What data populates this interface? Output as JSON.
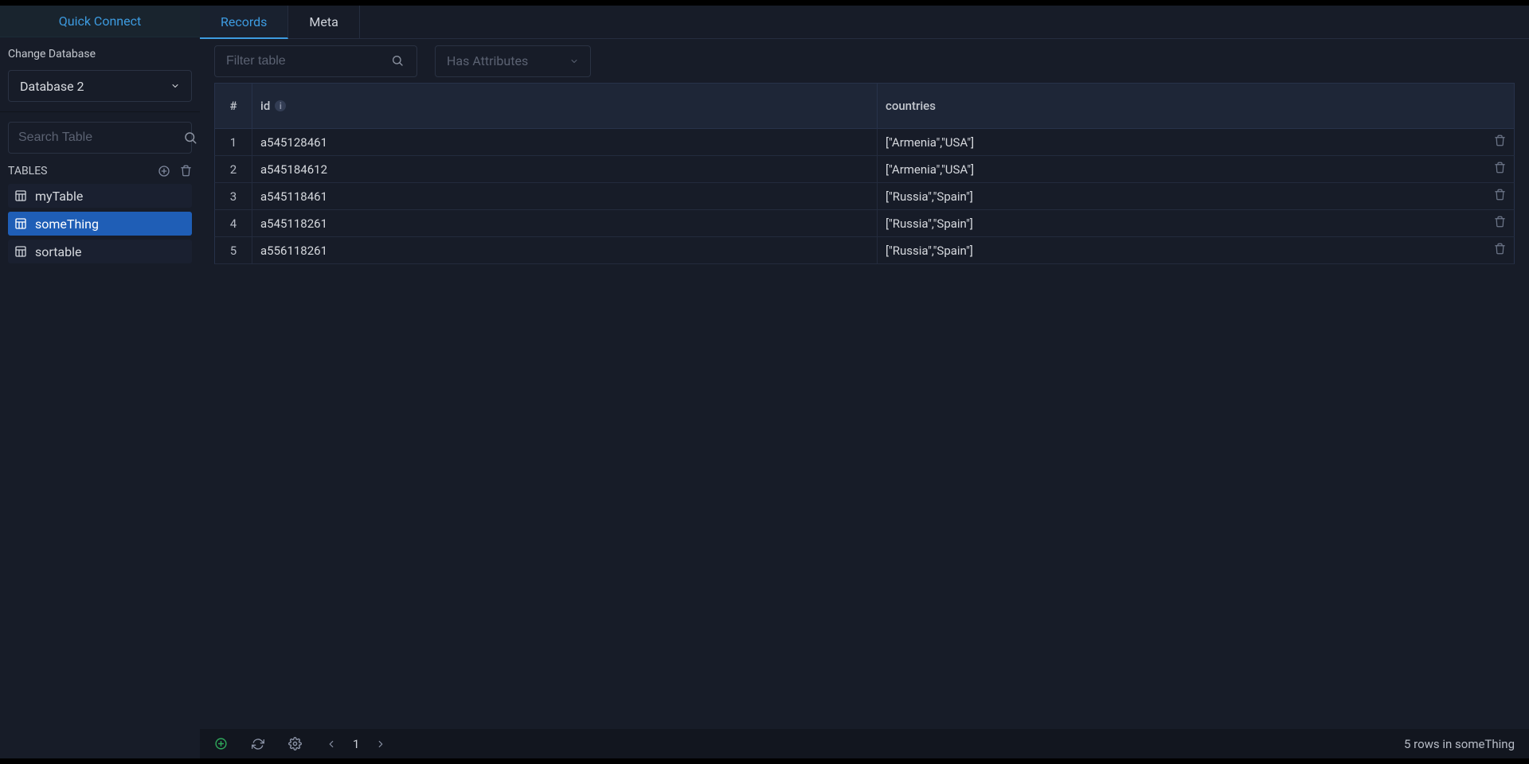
{
  "sidebar": {
    "quick_connect": "Quick Connect",
    "change_database_label": "Change Database",
    "selected_database": "Database 2",
    "search_placeholder": "Search Table",
    "tables_label": "TABLES",
    "tables": [
      {
        "name": "myTable"
      },
      {
        "name": "someThing"
      },
      {
        "name": "sortable"
      }
    ],
    "selected_table_index": 1
  },
  "tabs": [
    {
      "label": "Records",
      "active": true
    },
    {
      "label": "Meta",
      "active": false
    }
  ],
  "toolbar": {
    "filter_placeholder": "Filter table",
    "attr_label": "Has Attributes"
  },
  "columns": {
    "row_num": "#",
    "id": "id",
    "countries": "countries"
  },
  "rows": [
    {
      "n": "1",
      "id": "a545128461",
      "countries": "[\"Armenia\",\"USA\"]"
    },
    {
      "n": "2",
      "id": "a545184612",
      "countries": "[\"Armenia\",\"USA\"]"
    },
    {
      "n": "3",
      "id": "a545118461",
      "countries": "[\"Russia\",\"Spain\"]"
    },
    {
      "n": "4",
      "id": "a545118261",
      "countries": "[\"Russia\",\"Spain\"]"
    },
    {
      "n": "5",
      "id": "a556118261",
      "countries": "[\"Russia\",\"Spain\"]"
    }
  ],
  "footer": {
    "page": "1",
    "status": "5 rows in someThing"
  }
}
